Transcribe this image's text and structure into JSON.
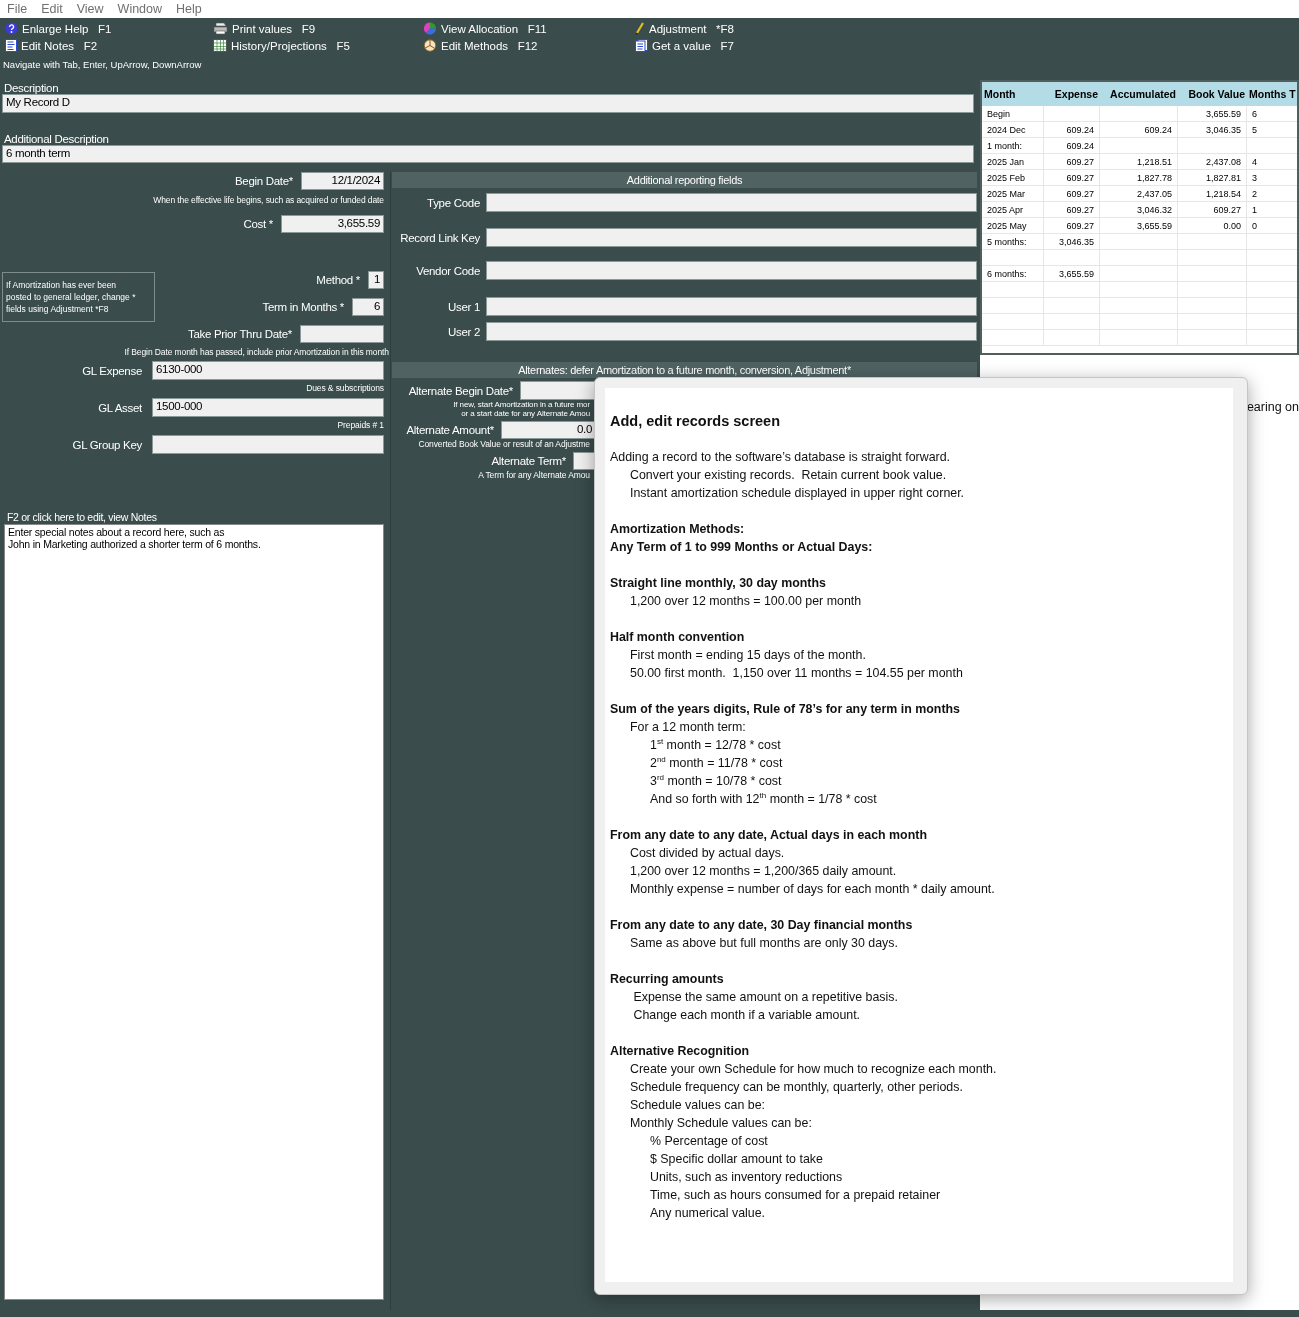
{
  "menu": [
    "File",
    "Edit",
    "View",
    "Window",
    "Help"
  ],
  "toolbar": [
    {
      "label": "Enlarge Help",
      "key": "F1"
    },
    {
      "label": "Edit Notes",
      "key": "F2"
    },
    {
      "label": "Print values",
      "key": "F9"
    },
    {
      "label": "History/Projections",
      "key": "F5"
    },
    {
      "label": "View Allocation",
      "key": "F11"
    },
    {
      "label": "Edit Methods",
      "key": "F12"
    },
    {
      "label": "Adjustment",
      "key": "*F8"
    },
    {
      "label": "Get a value",
      "key": "F7"
    }
  ],
  "nav_hint": "Navigate with Tab, Enter, UpArrow, DownArrow",
  "description": {
    "label": "Description",
    "value": "My Record D"
  },
  "additional_description": {
    "label": "Additional Description",
    "value": "6 month term"
  },
  "form": {
    "begin_date": {
      "label": "Begin Date*",
      "value": "12/1/2024",
      "hint": "When the effective life begins, such as acquired or funded date"
    },
    "cost": {
      "label": "Cost *",
      "value": "3,655.59"
    },
    "adjustment_note": "If Amortization has ever been\nposted to general ledger, change *\nfields using Adjustment  *F8",
    "method": {
      "label": "Method *",
      "value": "1"
    },
    "term": {
      "label": "Term in Months *",
      "value": "6"
    },
    "take_prior": {
      "label": "Take Prior Thru Date*",
      "hint": "If Begin Date month has passed, include prior Amortization in this month"
    },
    "gl_expense": {
      "label": "GL Expense",
      "value": "6130-000",
      "caption": "Dues & subscriptions"
    },
    "gl_asset": {
      "label": "GL Asset",
      "value": "1500-000",
      "caption": "Prepaids # 1"
    },
    "gl_group_key": {
      "label": "GL Group Key"
    }
  },
  "notes": {
    "label": "F2 or click here to edit, view Notes",
    "text": "Enter special notes about a record here, such as\nJohn in Marketing authorized a shorter term of 6 months."
  },
  "reporting": {
    "title": "Additional reporting fields",
    "fields": [
      {
        "label": "Type Code"
      },
      {
        "label": "Record Link Key"
      },
      {
        "label": "Vendor Code"
      },
      {
        "label": "User 1"
      },
      {
        "label": "User 2"
      }
    ]
  },
  "alternates": {
    "title": "Alternates: defer Amortization to a future month, conversion, Adjustment*",
    "begin_date": {
      "label": "Alternate Begin Date*",
      "hint": [
        "If new, start Amortization in a future mor",
        "or a start date for any Alternate Amou"
      ]
    },
    "amount": {
      "label": "Alternate Amount*",
      "value": "0.0",
      "hint": "Converted Book Value or result of an Adjustme"
    },
    "term": {
      "label": "Alternate Term*",
      "hint": "A Term for any Alternate Amou"
    }
  },
  "schedule": {
    "columns": [
      "Month",
      "Expense",
      "Accumulated",
      "Book Value",
      "Months T"
    ],
    "rows": [
      {
        "kind": "data",
        "cells": [
          "Begin",
          "",
          "",
          "3,655.59",
          "6"
        ]
      },
      {
        "kind": "data",
        "cells": [
          "2024 Dec",
          "609.24",
          "609.24",
          "3,046.35",
          "5"
        ]
      },
      {
        "kind": "data",
        "cells": [
          "1 month:",
          "609.24",
          "",
          "",
          ""
        ]
      },
      {
        "kind": "data",
        "cells": [
          "2025 Jan",
          "609.27",
          "1,218.51",
          "2,437.08",
          "4"
        ]
      },
      {
        "kind": "data",
        "cells": [
          "2025 Feb",
          "609.27",
          "1,827.78",
          "1,827.81",
          "3"
        ]
      },
      {
        "kind": "data",
        "cells": [
          "2025 Mar",
          "609.27",
          "2,437.05",
          "1,218.54",
          "2"
        ]
      },
      {
        "kind": "data",
        "cells": [
          "2025 Apr",
          "609.27",
          "3,046.32",
          "609.27",
          "1"
        ]
      },
      {
        "kind": "data",
        "cells": [
          "2025 May",
          "609.27",
          "3,655.59",
          "0.00",
          "0"
        ]
      },
      {
        "kind": "data",
        "cells": [
          "5 months:",
          "3,046.35",
          "",
          "",
          ""
        ]
      },
      {
        "kind": "blank"
      },
      {
        "kind": "data",
        "cells": [
          "6 months:",
          "3,655.59",
          "",
          "",
          ""
        ]
      }
    ]
  },
  "right_pane_text": "earing on",
  "help": {
    "title": "Add, edit records screen",
    "sections": [
      {
        "lines": [
          {
            "kind": "text",
            "text": "Adding a record to the software’s database is straight forward.",
            "children": [
              {
                "kind": "text",
                "text": "Convert your existing records.  Retain current book value."
              },
              {
                "kind": "text",
                "text": "Instant amortization schedule displayed in upper right corner."
              }
            ]
          }
        ]
      },
      {
        "lines": [
          {
            "kind": "heading",
            "text": "Amortization Methods:"
          },
          {
            "kind": "heading",
            "text": "Any Term of 1 to 999 Months or Actual Days:"
          }
        ]
      },
      {
        "lines": [
          {
            "kind": "heading",
            "text": "Straight line monthly, 30 day months",
            "children": [
              {
                "kind": "text",
                "text": "1,200 over 12 months = 100.00 per month"
              }
            ]
          }
        ]
      },
      {
        "lines": [
          {
            "kind": "heading",
            "text": "Half month convention",
            "children": [
              {
                "kind": "text",
                "text": "First month = ending 15 days of the month."
              },
              {
                "kind": "text",
                "text": "50.00 first month.  1,150 over 11 months = 104.55 per month"
              }
            ]
          }
        ]
      },
      {
        "lines": [
          {
            "kind": "heading",
            "text": "Sum of the years digits, Rule of 78’s for any term in months",
            "children": [
              {
                "kind": "text",
                "text": "For a 12 month term:",
                "children": [
                  {
                    "kind": "text",
                    "text": "1$^{st}$ month = 12/78 * cost"
                  },
                  {
                    "kind": "text",
                    "text": "2$^{nd}$ month = 11/78 * cost"
                  },
                  {
                    "kind": "text",
                    "text": "3$^{rd}$ month = 10/78 * cost"
                  },
                  {
                    "kind": "text",
                    "text": "And so forth with 12$^{th}$ month = 1/78 * cost"
                  }
                ]
              }
            ]
          }
        ]
      },
      {
        "lines": [
          {
            "kind": "heading",
            "text": "From any date to any date, Actual days in each month",
            "children": [
              {
                "kind": "text",
                "text": "Cost divided by actual days."
              },
              {
                "kind": "text",
                "text": "1,200 over 12 months = 1,200/365 daily amount."
              },
              {
                "kind": "text",
                "text": "Monthly expense = number of days for each month * daily amount."
              }
            ]
          }
        ]
      },
      {
        "lines": [
          {
            "kind": "heading",
            "text": "From any date to any date, 30 Day financial months",
            "children": [
              {
                "kind": "text",
                "text": "Same as above but full months are only 30 days."
              }
            ]
          }
        ]
      },
      {
        "lines": [
          {
            "kind": "heading",
            "text": "Recurring amounts",
            "children": [
              {
                "kind": "text",
                "text": " Expense the same amount on a repetitive basis."
              },
              {
                "kind": "text",
                "text": " Change each month if a variable amount."
              }
            ]
          }
        ]
      },
      {
        "lines": [
          {
            "kind": "heading",
            "text": "Alternative Recognition",
            "children": [
              {
                "kind": "text",
                "text": "Create your own Schedule for how much to recognize each month."
              },
              {
                "kind": "text",
                "text": "Schedule frequency can be monthly, quarterly, other periods."
              },
              {
                "kind": "text",
                "text": "Schedule values can be:"
              },
              {
                "kind": "text",
                "text": "Monthly Schedule values can be:",
                "children": [
                  {
                    "kind": "text",
                    "text": "% Percentage of cost"
                  },
                  {
                    "kind": "text",
                    "text": "$ Specific dollar amount to take"
                  },
                  {
                    "kind": "text",
                    "text": "Units, such as inventory reductions"
                  },
                  {
                    "kind": "text",
                    "text": "Time, such as hours consumed for a prepaid retainer"
                  },
                  {
                    "kind": "text",
                    "text": "Any numerical value."
                  }
                ]
              }
            ]
          }
        ]
      }
    ]
  }
}
